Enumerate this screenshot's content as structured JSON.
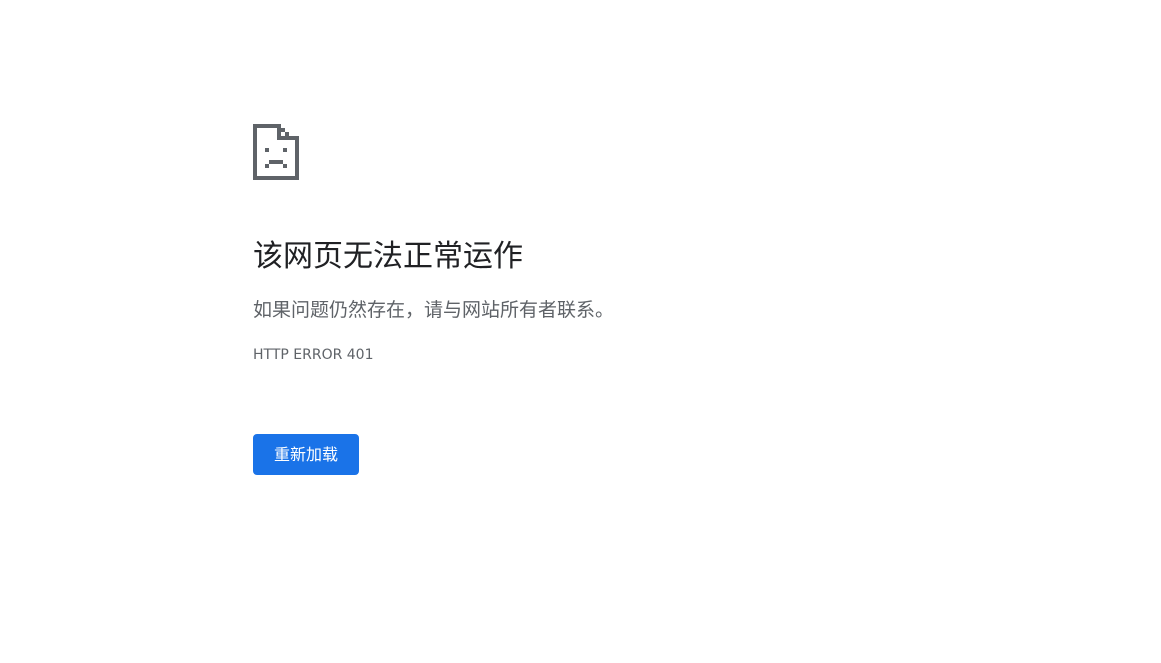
{
  "error_page": {
    "icon": "sad-document-icon",
    "title": "该网页无法正常运作",
    "message": "如果问题仍然存在，请与网站所有者联系。",
    "error_code": "HTTP ERROR 401",
    "reload_label": "重新加载"
  },
  "colors": {
    "icon": "#5f6368",
    "title": "#202124",
    "body_text": "#5f6368",
    "button_bg": "#1a73e8",
    "button_text": "#ffffff",
    "page_bg": "#ffffff"
  }
}
